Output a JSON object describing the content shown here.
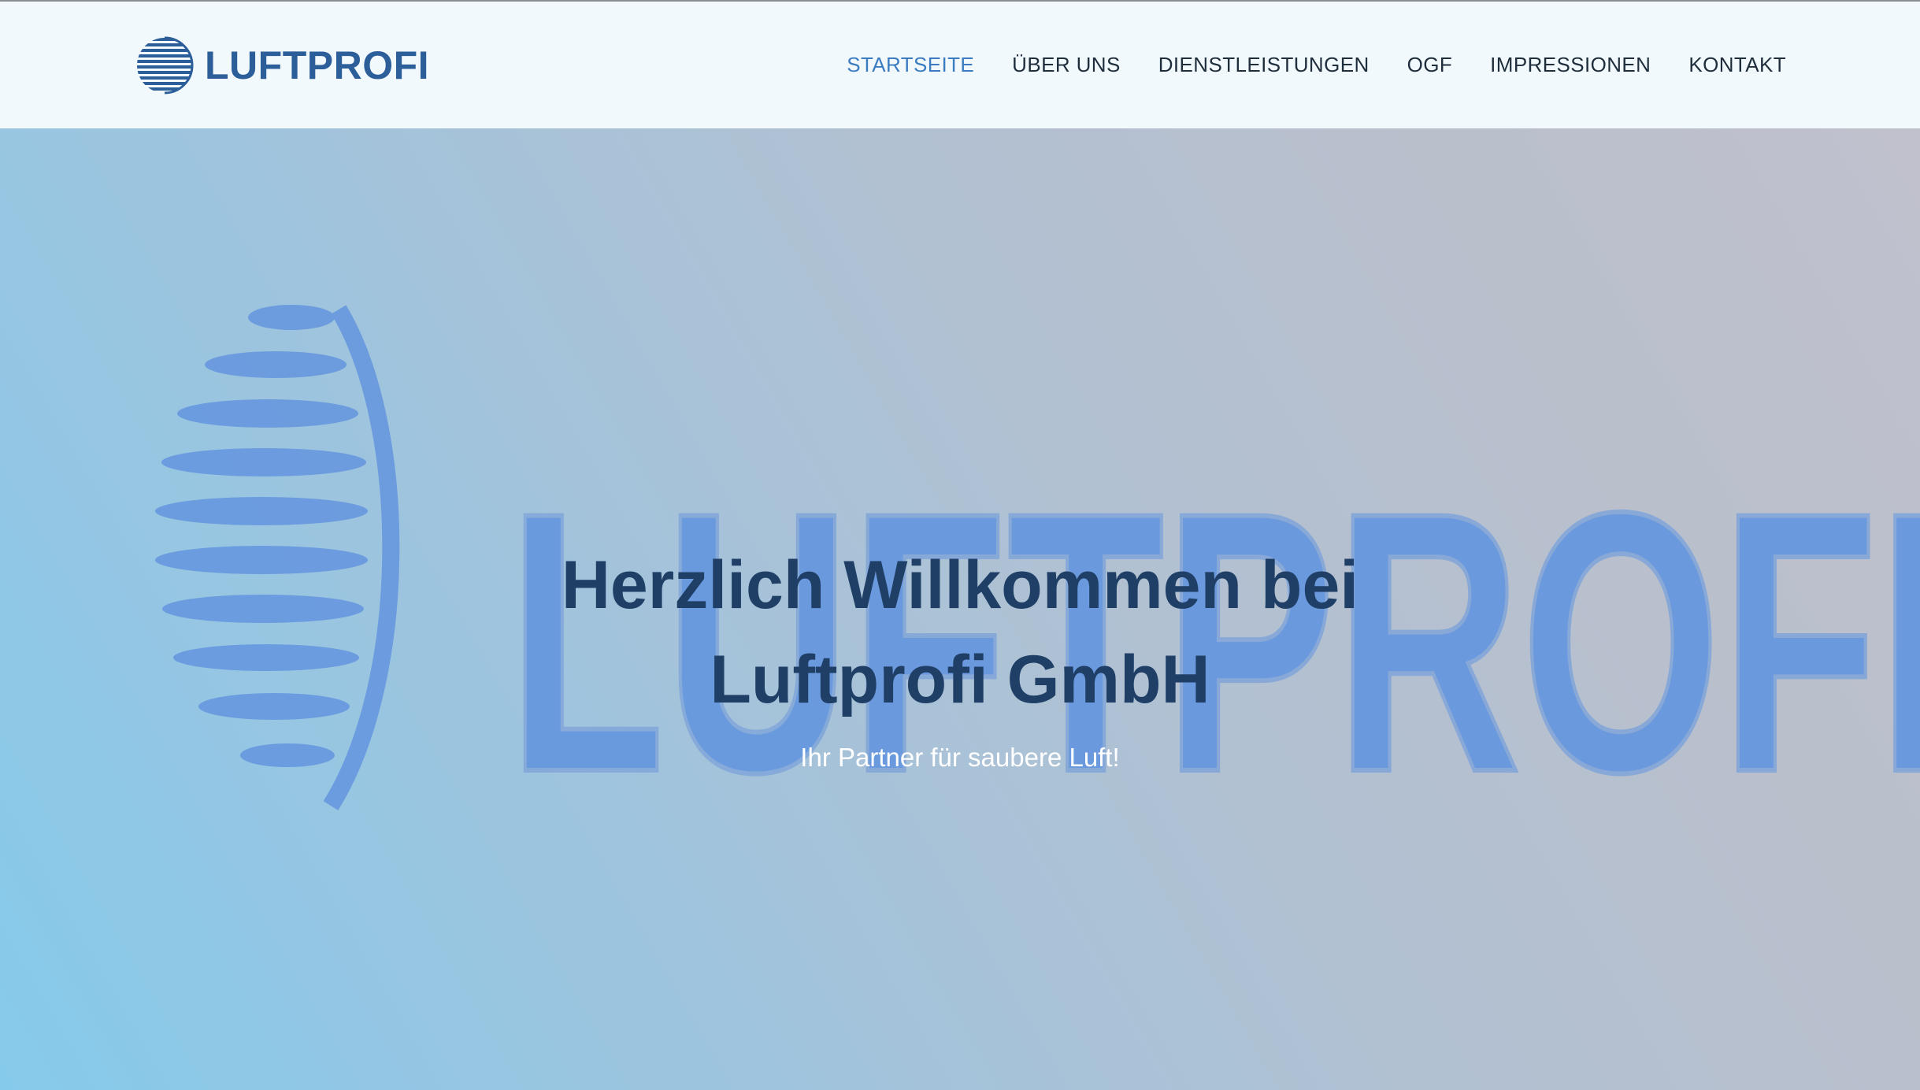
{
  "header": {
    "logo_text": "LUFTPROFI",
    "logo_icon": "striped-globe-icon",
    "nav": [
      {
        "label": "STARTSEITE",
        "active": true
      },
      {
        "label": "ÜBER UNS",
        "active": false
      },
      {
        "label": "DIENSTLEISTUNGEN",
        "active": false
      },
      {
        "label": "OGF",
        "active": false
      },
      {
        "label": "IMPRESSIONEN",
        "active": false
      },
      {
        "label": "KONTAKT",
        "active": false
      }
    ]
  },
  "hero": {
    "background_sign_text": "LUFTPROFI",
    "title": "Herzlich Willkommen bei Luftprofi GmbH",
    "subtitle": "Ihr Partner für saubere Luft!"
  },
  "colors": {
    "brand_blue": "#2c5e9a",
    "nav_active": "#3b7cc0",
    "nav_text": "#1f2e3c",
    "hero_title": "#1f3f66",
    "sign_blue": "#5b8fe0"
  }
}
